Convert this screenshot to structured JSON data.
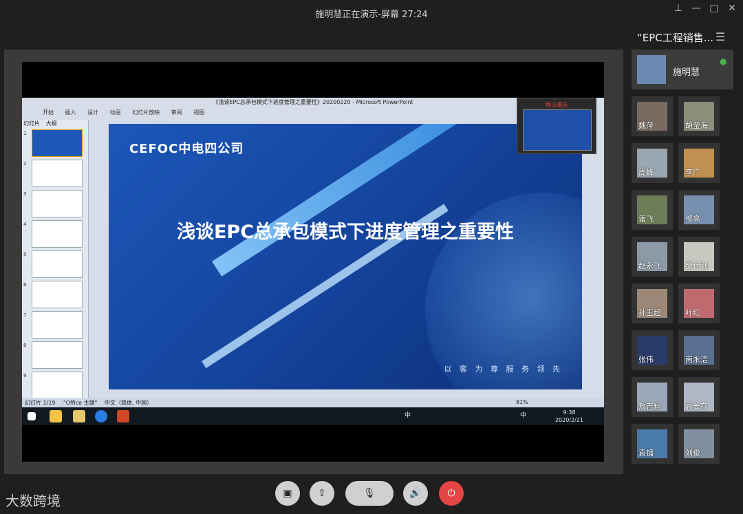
{
  "header": {
    "title": "施明慧正在演示-屏幕 27:24"
  },
  "window_controls": {
    "pin": "⊥",
    "minimize": "—",
    "maximize": "□",
    "close": "✕"
  },
  "side_panel": {
    "title": "“EPC工程销售...",
    "list_icon": "list-icon",
    "host": {
      "name": "施明慧",
      "mic": "mic-on-icon"
    },
    "participants": [
      "魏萍",
      "胡莹海",
      "周峰-",
      "李广",
      "雷飞",
      "邹亮",
      "赵永飞",
      "樊计划",
      "孙玉超",
      "叶红",
      "张伟",
      "南永洁",
      "敖吉翔",
      "袁长存",
      "袁镭",
      "刘俊"
    ]
  },
  "ppt": {
    "title": "《浅谈EPC总承包模式下进度管理之重要性》20200220 - Microsoft PowerPoint",
    "ribbon_tabs": [
      "开始",
      "插入",
      "设计",
      "动画",
      "幻灯片放映",
      "审阅",
      "视图"
    ],
    "panel_tabs": [
      "幻灯片",
      "大纲"
    ],
    "slide_numbers": [
      "1",
      "2",
      "3",
      "4",
      "5",
      "6",
      "7",
      "8",
      "9"
    ],
    "slide": {
      "logo": "CEFOC中电四公司",
      "headline": "浅谈EPC总承包模式下进度管理之重要性",
      "slogan": "以 客 为 尊   服 务 领 先"
    },
    "status": {
      "slide_info": "幻灯片 1/19",
      "theme": "\"Office 主题\"",
      "language": "中文（简体, 中国）",
      "zoom": "81%"
    },
    "stop_label": "停止演示"
  },
  "taskbar": {
    "time": "9:38",
    "date": "2020/2/21",
    "ime": "中",
    "ime2": "中"
  },
  "controls": {
    "share_icon": "screen-share-icon",
    "file_icon": "file-transfer-icon",
    "mic_icon": "mic-muted-icon",
    "speaker_icon": "speaker-icon",
    "end_icon": "power-icon"
  },
  "watermark": "大数跨境",
  "colors": {
    "accent": "#1d57b8",
    "end": "#e64545",
    "mic": "#4caf50"
  }
}
